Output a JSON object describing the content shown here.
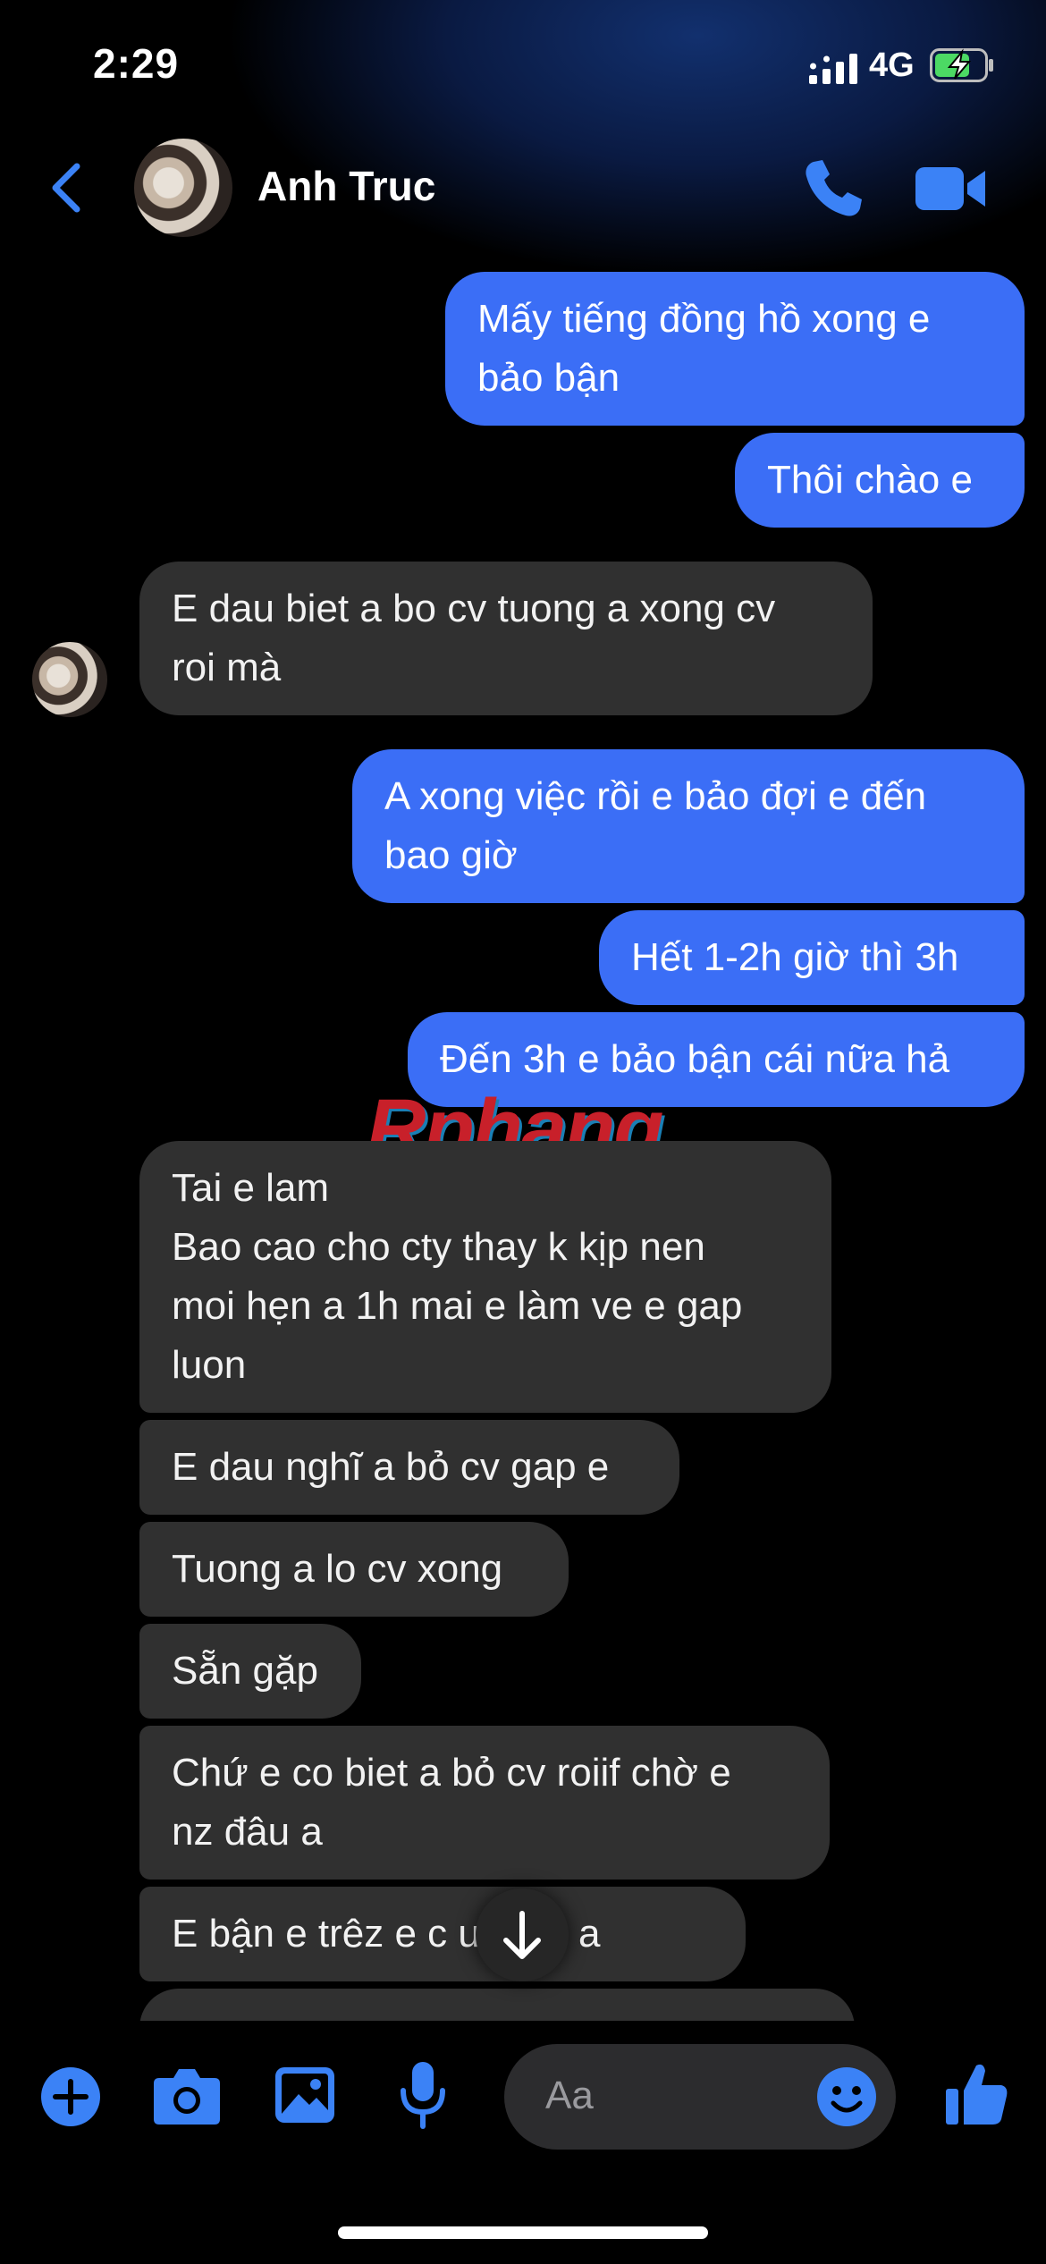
{
  "status_bar": {
    "time": "2:29",
    "network": "4G"
  },
  "header": {
    "contact_name": "Anh Truc"
  },
  "messages": [
    {
      "from": "me",
      "text": "Mấy tiếng đồng hồ xong e\nbảo bận"
    },
    {
      "from": "me",
      "text": "Thôi chào e"
    },
    {
      "from": "them",
      "text": "E dau biet a bo cv tuong a xong cv\nroi mà"
    },
    {
      "from": "me",
      "text": "A xong việc rồi e bảo đợi e đến\nbao giờ"
    },
    {
      "from": "me",
      "text": "Hết 1-2h giờ thì 3h"
    },
    {
      "from": "me",
      "text": "Đến 3h e bảo bận cái nữa hả"
    },
    {
      "from": "them",
      "text": "Tai e lam\nBao cao cho cty thay k kịp nen\nmoi hẹn a 1h mai e làm ve e gap\nluon"
    },
    {
      "from": "them",
      "text": "E dau nghĩ a bỏ cv gap e"
    },
    {
      "from": "them",
      "text": "Tuong a lo cv xong"
    },
    {
      "from": "them",
      "text": "Sẵn gặp"
    },
    {
      "from": "them",
      "text": "Chứ e co biet a bỏ cv roiif chờ e\nnz đâu a"
    },
    {
      "from": "them",
      "text": "E bận e trêz e c     ut báo a"
    }
  ],
  "watermark": "Rphang",
  "composer": {
    "placeholder": "Aa"
  },
  "colors": {
    "accent": "#3b6ef6",
    "incoming_bubble": "#303030",
    "background": "#000000"
  }
}
